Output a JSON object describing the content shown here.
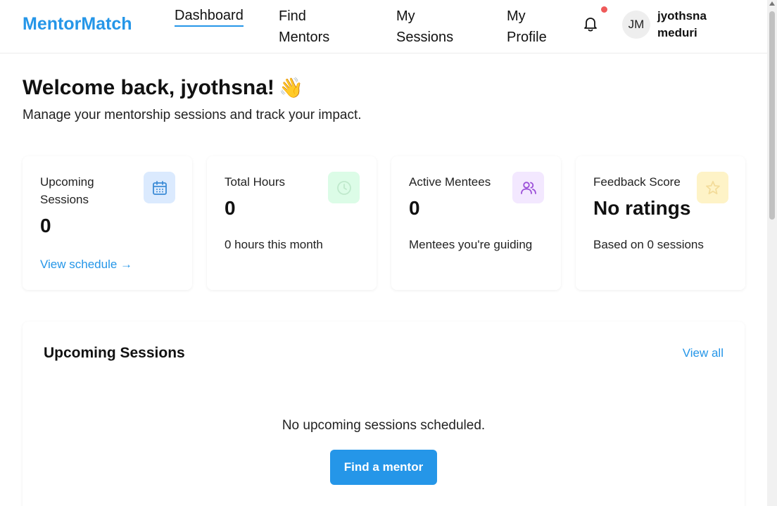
{
  "header": {
    "brand": "MentorMatch",
    "nav": [
      {
        "line1": "Dashboard",
        "line2": ""
      },
      {
        "line1": "Find",
        "line2": "Mentors"
      },
      {
        "line1": "My",
        "line2": "Sessions"
      },
      {
        "line1": "My",
        "line2": "Profile"
      }
    ],
    "avatar_initials": "JM",
    "user_first": "jyothsna",
    "user_last": "meduri"
  },
  "welcome": {
    "title": "Welcome back, jyothsna!",
    "emoji": "👋",
    "subtitle": "Manage your mentorship sessions and track your impact."
  },
  "stats": [
    {
      "label_line1": "Upcoming",
      "label_line2": "Sessions",
      "value": "0",
      "link": "View schedule →",
      "icon": "calendar-icon",
      "icon_bg": "#dbeafe",
      "icon_color": "#3b8bd6"
    },
    {
      "label_line1": "Total Hours",
      "value": "0",
      "sub": "0 hours this month",
      "icon": "clock-icon",
      "icon_bg": "#dcfce7",
      "icon_color": "#bfe9cc"
    },
    {
      "label_line1": "Active Mentees",
      "value": "0",
      "sub": "Mentees you're guiding",
      "icon": "users-icon",
      "icon_bg": "#f3e8ff",
      "icon_color": "#9b4fd8"
    },
    {
      "label_line1": "Feedback Score",
      "value": "No ratings",
      "sub": "Based on 0 sessions",
      "icon": "star-icon",
      "icon_bg": "#fef3c7",
      "icon_color": "#f3dc9a"
    }
  ],
  "upcoming": {
    "title": "Upcoming Sessions",
    "view_all": "View all",
    "empty": "No upcoming sessions scheduled.",
    "cta": "Find a mentor"
  },
  "colors": {
    "accent": "#2596e8",
    "notification_dot": "#ef5a5a"
  }
}
